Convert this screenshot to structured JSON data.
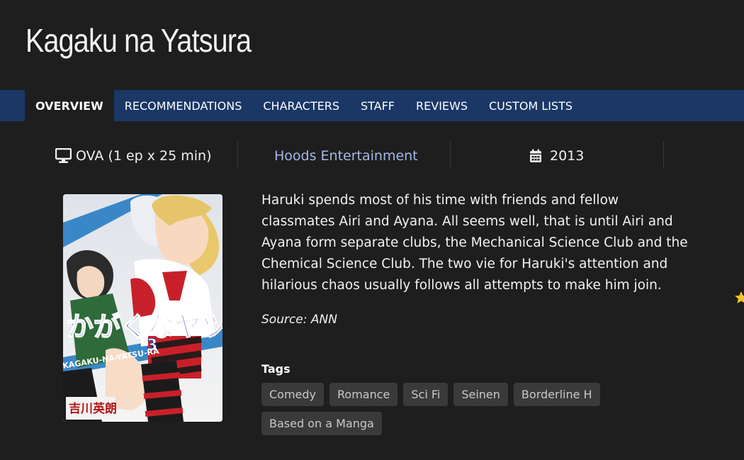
{
  "page": {
    "title": "Kagaku na Yatsura"
  },
  "tabs": [
    {
      "label": "OVERVIEW",
      "active": true
    },
    {
      "label": "RECOMMENDATIONS",
      "active": false
    },
    {
      "label": "CHARACTERS",
      "active": false
    },
    {
      "label": "STAFF",
      "active": false
    },
    {
      "label": "REVIEWS",
      "active": false
    },
    {
      "label": "CUSTOM LISTS",
      "active": false
    }
  ],
  "info": {
    "type": "OVA (1 ep x 25 min)",
    "type_icon": "monitor-icon",
    "studio": "Hoods Entertainment",
    "year": "2013",
    "year_icon": "calendar-icon",
    "rating_icon": "star-icon"
  },
  "synopsis": "Haruki spends most of his time with friends and fellow classmates Airi and Ayana. All seems well, that is until Airi and Ayana form separate clubs, the Mechanical Science Club and the Chemical Science Club. The two vie for Haruki's attention and hilarious chaos usually follows all attempts to make him join.",
  "source": "Source: ANN",
  "tags_label": "Tags",
  "tags": [
    "Comedy",
    "Romance",
    "Sci Fi",
    "Seinen",
    "Borderline H",
    "Based on a Manga"
  ],
  "cover": {
    "title_art": "かがくなヤツら",
    "volume": "3",
    "author": "吉川英朗",
    "banner": "KAGAKU-NA-YATSU-RA"
  },
  "colors": {
    "background": "#1e1e1e",
    "tabbar": "#1a3766",
    "studio_link": "#a6b8e8",
    "tag_bg": "#3a3a3a"
  }
}
